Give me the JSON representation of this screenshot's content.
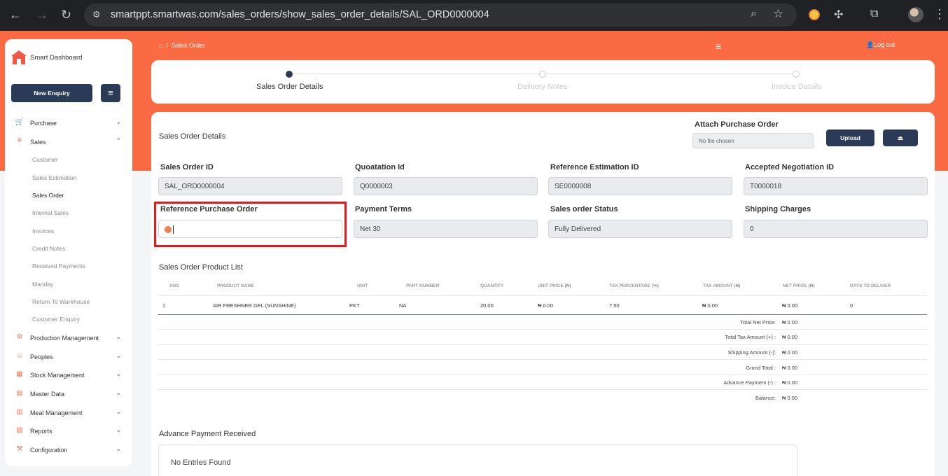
{
  "browser": {
    "url": "smartppt.smartwas.com/sales_orders/show_sales_order_details/SAL_ORD0000004"
  },
  "sidebar": {
    "brand": "Smart Dashboard",
    "new_enquiry": "New Enquiry",
    "items": [
      {
        "label": "Purchase",
        "icon": "cart-icon"
      },
      {
        "label": "Sales",
        "icon": "sales-icon"
      },
      {
        "label": "Production Management",
        "icon": "factory-icon"
      },
      {
        "label": "Peoples",
        "icon": "people-icon"
      },
      {
        "label": "Stock Management",
        "icon": "stock-icon"
      },
      {
        "label": "Master Data",
        "icon": "database-icon"
      },
      {
        "label": "Meal Management",
        "icon": "meal-icon"
      },
      {
        "label": "Reports",
        "icon": "reports-icon"
      },
      {
        "label": "Configuration",
        "icon": "config-icon"
      }
    ],
    "sales_sub": [
      "Customer",
      "Sales Estimation",
      "Sales Order",
      "Internal Sales",
      "Invoices",
      "Credit Notes",
      "Received Payments",
      "Manday",
      "Return To Warehouse",
      "Customer Enquiry"
    ]
  },
  "topbar": {
    "breadcrumb_sep": "/",
    "breadcrumb": "Sales Order",
    "logout": "Log out"
  },
  "stepper": [
    "Sales Order Details",
    "Delivery Notes",
    "Invoice Details"
  ],
  "main": {
    "title": "Sales Order Details",
    "attach_title": "Attach Purchase Order",
    "file_placeholder": "No file chosen",
    "upload": "Upload",
    "fields": {
      "sales_order_id": {
        "label": "Sales Order ID",
        "value": "SAL_ORD0000004"
      },
      "quotation_id": {
        "label": "Quoatation Id",
        "value": "Q0000003"
      },
      "reference_estimation_id": {
        "label": "Reference Estimation ID",
        "value": "SE0000008"
      },
      "accepted_negotiation_id": {
        "label": "Accepted Negotiation ID",
        "value": "T0000018"
      },
      "reference_purchase_order": {
        "label": "Reference Purchase Order",
        "value": ""
      },
      "payment_terms": {
        "label": "Payment Terms",
        "value": "Net 30"
      },
      "sales_order_status": {
        "label": "Sales order Status",
        "value": "Fully Delivered"
      },
      "shipping_charges": {
        "label": "Shipping Charges",
        "value": "0"
      }
    },
    "product_list_title": "Sales Order Product List",
    "table": {
      "headers": [
        "SNO",
        "PRODUCT NAME",
        "UNIT",
        "PART NUMBER",
        "QUANTITY",
        "UNIT PRICE (₦)",
        "TAX PERCENTAGE (%)",
        "TAX AMOUNT (₦)",
        "NET PRICE (₦)",
        "DAYS TO DELIVER"
      ],
      "rows": [
        [
          "1",
          "AIR FRESHNER GEL (SUNSHINE)",
          "PKT",
          "NA",
          "20.00",
          "₦ 0.00",
          "7.50",
          "₦ 0.00",
          "₦ 0.00",
          "0"
        ]
      ]
    },
    "summary": [
      {
        "label": "Total Net Price:",
        "value": "₦ 0.00"
      },
      {
        "label": "Total Tax Amount (+) :",
        "value": "₦ 0.00"
      },
      {
        "label": "Shipping Amount (-):",
        "value": "₦ 0.00"
      },
      {
        "label": "Grand Total :",
        "value": "₦ 0.00"
      },
      {
        "label": "Advance Payment (-) :",
        "value": "₦ 0.00"
      },
      {
        "label": "Balance:",
        "value": "₦ 0.00"
      }
    ],
    "advance_title": "Advance Payment Received",
    "no_entries": "No Entries Found"
  },
  "colors": {
    "accent": "#fa6a43",
    "primary_button": "#2b3a57",
    "highlight": "#e01b1b"
  }
}
